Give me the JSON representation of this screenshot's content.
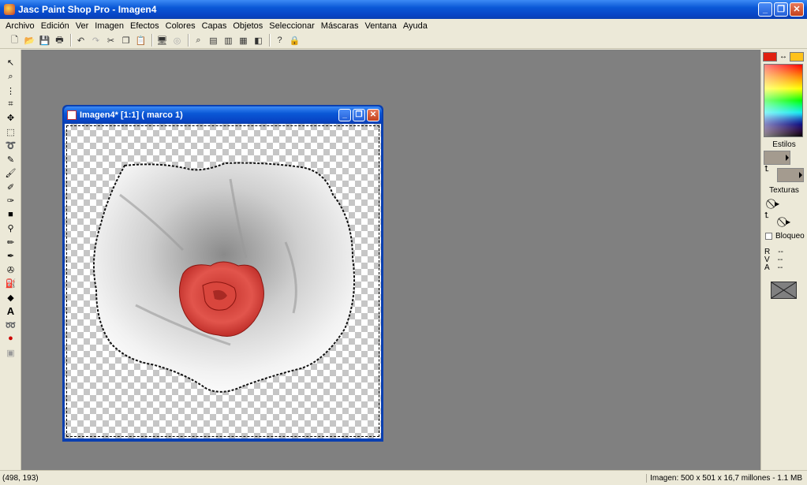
{
  "window": {
    "title": "Jasc Paint Shop Pro - Imagen4"
  },
  "menu": [
    "Archivo",
    "Edición",
    "Ver",
    "Imagen",
    "Efectos",
    "Colores",
    "Capas",
    "Objetos",
    "Seleccionar",
    "Máscaras",
    "Ventana",
    "Ayuda"
  ],
  "toolbar_icons": [
    "new-icon",
    "open-icon",
    "save-icon",
    "print-icon",
    "undo-icon",
    "redo-icon",
    "cut-icon",
    "copy-icon",
    "paste-icon",
    "browse-icon",
    "capture-icon",
    "zoom-icon",
    "histogram-icon",
    "palette-icon",
    "layers-icon",
    "overview-icon",
    "help-icon",
    "lock-icon"
  ],
  "tools": [
    "arrow-icon",
    "zoom-icon",
    "deform-icon",
    "crop-icon",
    "move-icon",
    "selection-icon",
    "freehand-icon",
    "dropper-icon",
    "paintbrush-icon",
    "clone-icon",
    "color-replacer-icon",
    "retouch-icon",
    "scratch-icon",
    "eraser-icon",
    "picture-tube-icon",
    "airbrush-icon",
    "flood-fill-icon",
    "text-icon",
    "draw-icon",
    "preset-shapes-icon",
    "object-selector-icon"
  ],
  "image_window": {
    "title": "Imagen4* [1:1] ( marco 1)"
  },
  "colors": {
    "foreground": "#e02010",
    "background": "#ffc21a"
  },
  "right_panel": {
    "styles_label": "Estilos",
    "textures_label": "Texturas",
    "lock_label": "Bloqueo",
    "r_label": "R",
    "r_value": "--",
    "v_label": "V",
    "v_value": "--",
    "a_label": "A",
    "a_value": "--"
  },
  "status": {
    "coords": "(498, 193)",
    "image_info": "Imagen:  500 x 501 x 16,7 millones - 1.1 MB"
  }
}
